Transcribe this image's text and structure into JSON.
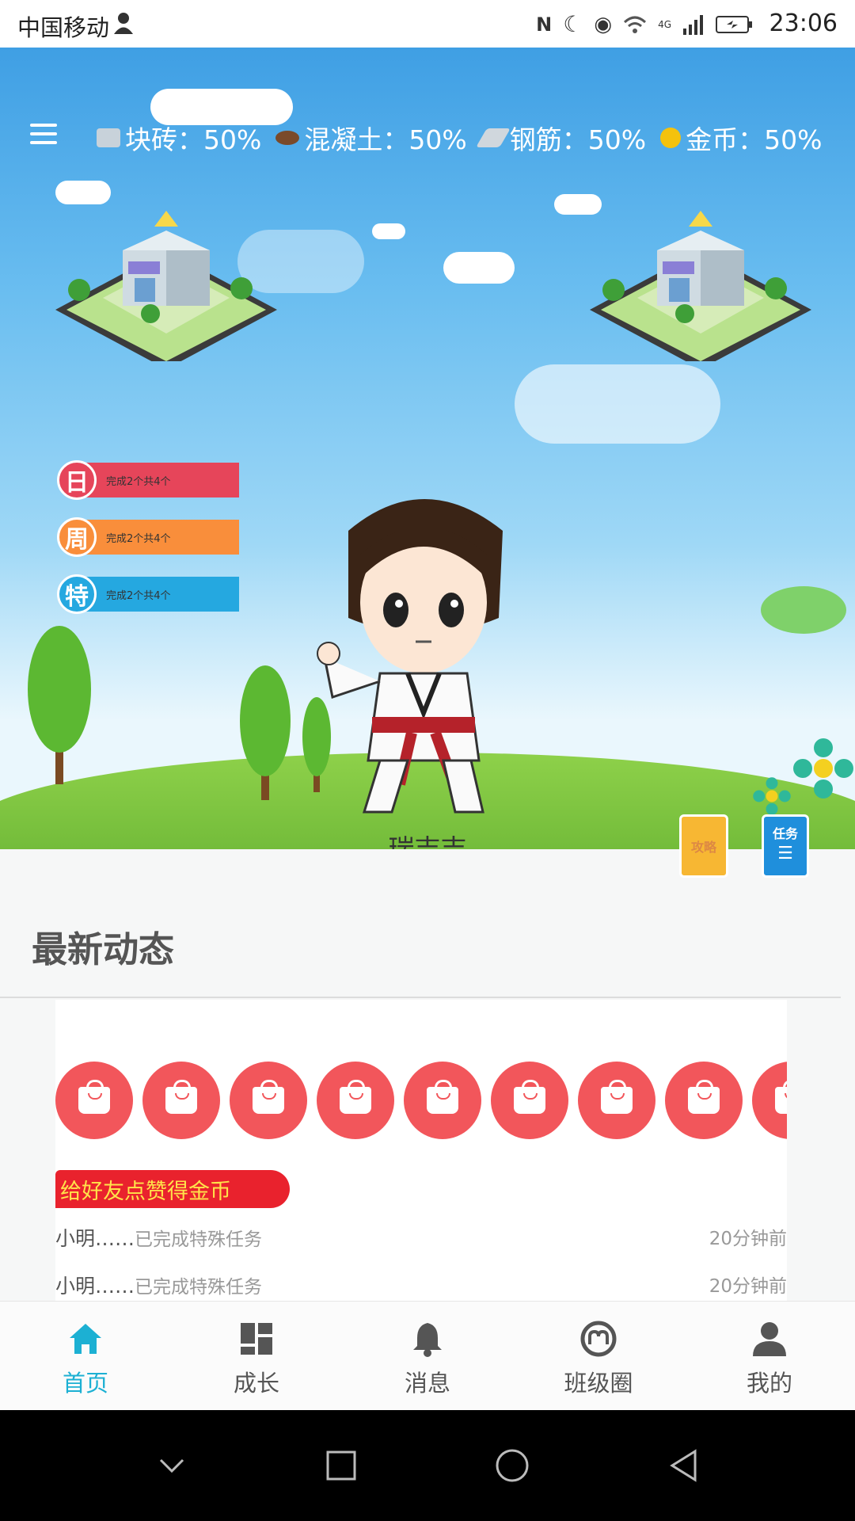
{
  "status_bar": {
    "carrier": "中国移动",
    "time": "23:06",
    "network": "4G"
  },
  "resources": [
    {
      "icon": "brick-icon",
      "label": "块砖：50%",
      "color": "#c8d2da"
    },
    {
      "icon": "concrete-icon",
      "label": "混凝土：50%",
      "color": "#7a4a2a"
    },
    {
      "icon": "rebar-icon",
      "label": "钢筋：50%",
      "color": "#d0d7dd"
    },
    {
      "icon": "coin-icon",
      "label": "金币：50%",
      "color": "#f4c20d"
    }
  ],
  "tasks": [
    {
      "badge": "日",
      "text": "完成2个共4个",
      "color": "#e6455a"
    },
    {
      "badge": "周",
      "text": "完成2个共4个",
      "color": "#f98e3b"
    },
    {
      "badge": "特",
      "text": "完成2个共4个",
      "color": "#25a8e0"
    }
  ],
  "character_name": "瑞吉吉",
  "side_buttons": {
    "guide": "攻略",
    "task": "任务"
  },
  "news": {
    "title": "最新动态",
    "promo": "给好友点赞得金币",
    "items": [
      {
        "who": "小明……",
        "action": "已完成特殊任务",
        "time": "20分钟前"
      },
      {
        "who": "小明……",
        "action": "已完成特殊任务",
        "time": "20分钟前"
      }
    ]
  },
  "tabs": [
    {
      "label": "首页",
      "icon": "home-icon",
      "active": true
    },
    {
      "label": "成长",
      "icon": "dashboard-icon",
      "active": false
    },
    {
      "label": "消息",
      "icon": "bell-icon",
      "active": false
    },
    {
      "label": "班级圈",
      "icon": "circle-icon",
      "active": false
    },
    {
      "label": "我的",
      "icon": "user-icon",
      "active": false
    }
  ],
  "colors": {
    "accent": "#1cb0d3",
    "bag": "#f2565b",
    "promo_bg": "#e9222d",
    "promo_text": "#ffe34a"
  }
}
